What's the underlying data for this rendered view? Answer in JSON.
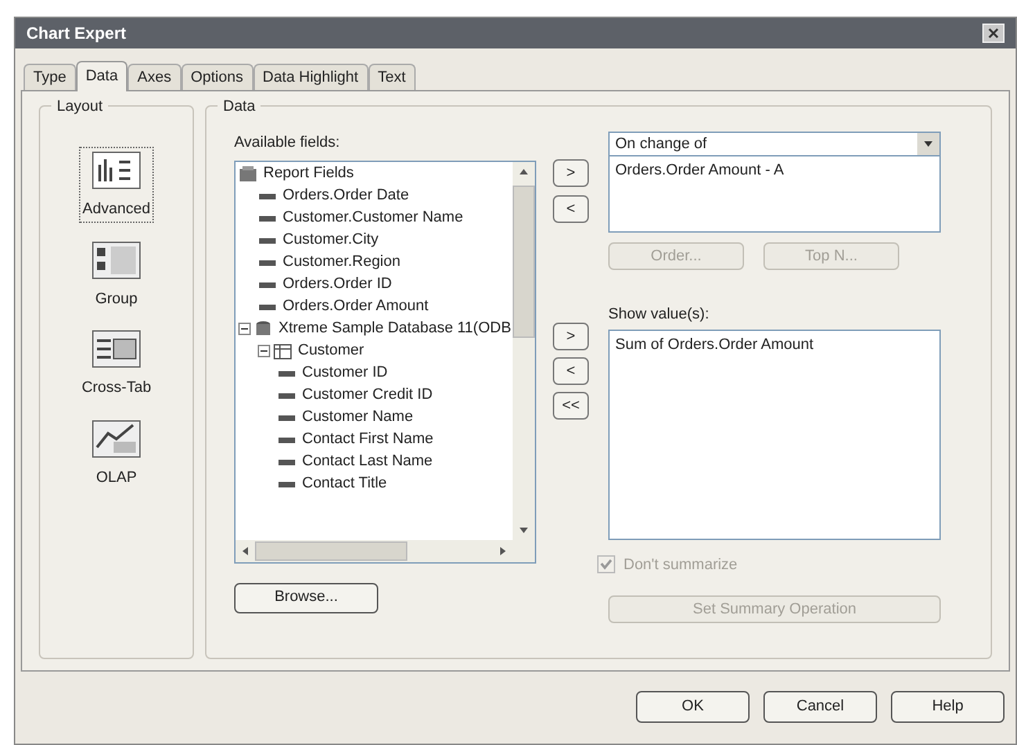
{
  "window": {
    "title": "Chart Expert"
  },
  "tabs": [
    {
      "label": "Type",
      "selected": false
    },
    {
      "label": "Data",
      "selected": true
    },
    {
      "label": "Axes",
      "selected": false
    },
    {
      "label": "Options",
      "selected": false
    },
    {
      "label": "Data Highlight",
      "selected": false
    },
    {
      "label": "Text",
      "selected": false
    }
  ],
  "layout": {
    "title": "Layout",
    "items": [
      {
        "label": "Advanced",
        "kind": "advanced",
        "selected": true
      },
      {
        "label": "Group",
        "kind": "group",
        "selected": false
      },
      {
        "label": "Cross-Tab",
        "kind": "crosstab",
        "selected": false
      },
      {
        "label": "OLAP",
        "kind": "olap",
        "selected": false
      }
    ]
  },
  "data": {
    "title": "Data",
    "available_label": "Available fields:",
    "tree": [
      {
        "label": "Report Fields",
        "kind": "folder",
        "children": [
          {
            "label": "Orders.Order Date",
            "kind": "field"
          },
          {
            "label": "Customer.Customer Name",
            "kind": "field"
          },
          {
            "label": "Customer.City",
            "kind": "field"
          },
          {
            "label": "Customer.Region",
            "kind": "field"
          },
          {
            "label": "Orders.Order ID",
            "kind": "field"
          },
          {
            "label": "Orders.Order Amount",
            "kind": "field"
          }
        ]
      },
      {
        "label": "Xtreme Sample Database 11(ODB",
        "kind": "database",
        "expanded": true,
        "children": [
          {
            "label": "Customer",
            "kind": "table",
            "expanded": true,
            "children": [
              {
                "label": "Customer ID",
                "kind": "field"
              },
              {
                "label": "Customer Credit ID",
                "kind": "field"
              },
              {
                "label": "Customer Name",
                "kind": "field"
              },
              {
                "label": "Contact First Name",
                "kind": "field"
              },
              {
                "label": "Contact Last Name",
                "kind": "field"
              },
              {
                "label": "Contact Title",
                "kind": "field"
              }
            ]
          }
        ]
      }
    ],
    "browse": "Browse...",
    "arrows_top": [
      ">",
      "<"
    ],
    "arrows_bottom": [
      ">",
      "<",
      "<<"
    ],
    "on_change": {
      "value": "On change of",
      "items": [
        "Orders.Order Amount - A"
      ]
    },
    "order_buttons": [
      {
        "label": "Order...",
        "disabled": true
      },
      {
        "label": "Top N...",
        "disabled": true
      }
    ],
    "show_label": "Show value(s):",
    "show_items": [
      "Sum of Orders.Order Amount"
    ],
    "dont_summarize": {
      "label": "Don't summarize",
      "checked": true,
      "disabled": true
    },
    "summary_button": {
      "label": "Set Summary Operation",
      "disabled": true
    }
  },
  "footer": [
    "OK",
    "Cancel",
    "Help"
  ]
}
